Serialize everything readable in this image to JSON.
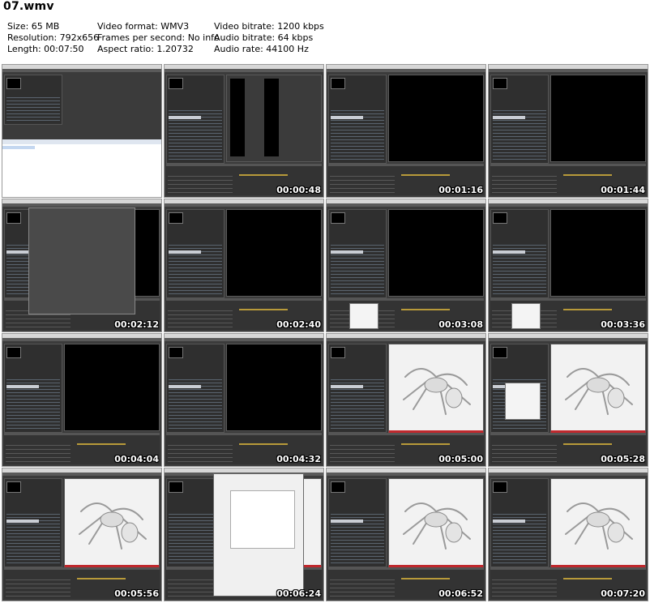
{
  "file": {
    "title": "07.wmv"
  },
  "info": {
    "size": "Size: 65 MB",
    "resolution": "Resolution: 792x656",
    "length": "Length: 00:07:50",
    "video_format": "Video format: WMV3",
    "fps": "Frames per second: No info",
    "aspect": "Aspect ratio: 1.20732",
    "video_bitrate": "Video bitrate: 1200 kbps",
    "audio_bitrate": "Audio bitrate: 64 kbps",
    "audio_rate": "Audio rate: 44100 Hz"
  },
  "thumbnails": [
    {
      "timestamp": "",
      "kind": "explorer"
    },
    {
      "timestamp": "00:00:48",
      "kind": "bars"
    },
    {
      "timestamp": "00:01:16",
      "kind": "dark"
    },
    {
      "timestamp": "00:01:44",
      "kind": "dark"
    },
    {
      "timestamp": "00:02:12",
      "kind": "dialog"
    },
    {
      "timestamp": "00:02:40",
      "kind": "dark"
    },
    {
      "timestamp": "00:03:08",
      "kind": "dark-menu"
    },
    {
      "timestamp": "00:03:36",
      "kind": "dark-menu"
    },
    {
      "timestamp": "00:04:04",
      "kind": "dark"
    },
    {
      "timestamp": "00:04:32",
      "kind": "dark"
    },
    {
      "timestamp": "00:05:00",
      "kind": "white"
    },
    {
      "timestamp": "00:05:28",
      "kind": "white-menu"
    },
    {
      "timestamp": "00:05:56",
      "kind": "white"
    },
    {
      "timestamp": "00:06:24",
      "kind": "filedialog"
    },
    {
      "timestamp": "00:06:52",
      "kind": "white"
    },
    {
      "timestamp": "00:07:20",
      "kind": "white"
    }
  ]
}
